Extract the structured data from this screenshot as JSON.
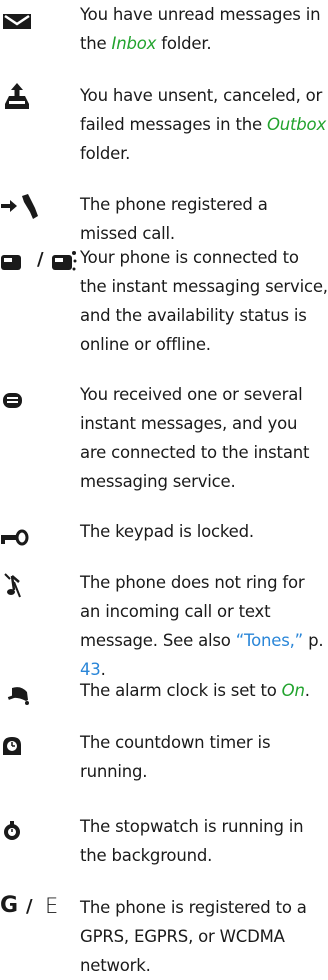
{
  "colors": {
    "folder_link": "#22a32e",
    "xref_link": "#2a86d8",
    "icon": "#1a1a1a"
  },
  "entries": [
    {
      "icon": "envelope-icon",
      "t1": "You have unread messages in the ",
      "link": "Inbox",
      "t2": " folder."
    },
    {
      "icon": "outbox-icon",
      "t1": "You have unsent, canceled, or failed messages in the ",
      "link": "Outbox",
      "t2": " folder."
    },
    {
      "icon": "missed-call-icon",
      "text": "The phone registered a missed call."
    },
    {
      "icon": "im-status-icon",
      "separator": "/",
      "text": "Your phone is connected to the instant messaging service, and the availability status is online or offline."
    },
    {
      "icon": "instant-message-icon",
      "text": "You received one or several instant messages, and you are connected to the instant messaging service."
    },
    {
      "icon": "keypad-lock-icon",
      "text": "The keypad is locked."
    },
    {
      "icon": "silent-icon",
      "t1": "The phone does not ring for an incoming call or text message. See also ",
      "link": "“Tones,”",
      "t2": " p. ",
      "page": "43",
      "t3": "."
    },
    {
      "icon": "alarm-bell-icon",
      "t1": "The alarm clock is set to ",
      "link": "On",
      "t2": "."
    },
    {
      "icon": "countdown-timer-icon",
      "text": "The countdown timer is running."
    },
    {
      "icon": "stopwatch-icon",
      "text": "The stopwatch is running in the background."
    },
    {
      "icon": "gprs-edge-icon",
      "g": "G",
      "separator": "/",
      "e": "E",
      "text": "The phone is registered to a GPRS, EGPRS, or WCDMA network."
    }
  ]
}
